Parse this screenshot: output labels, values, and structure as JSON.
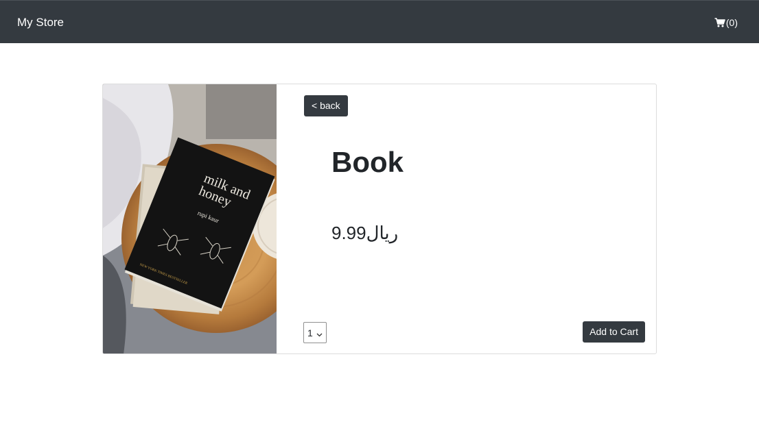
{
  "navbar": {
    "brand": "My Store",
    "cart_icon": "shopping-cart-icon",
    "cart_count": "(0)"
  },
  "product": {
    "back_label": "< back",
    "name": "Book",
    "price": "9.99ريال",
    "quantity": "1",
    "add_to_cart_label": "Add to Cart",
    "image": {
      "book_title_line1": "milk and",
      "book_title_line2": "honey",
      "book_author": "rupi kaur",
      "book_footer": "NEW YORK TIMES BESTSELLER"
    }
  },
  "colors": {
    "navbar_bg": "#343a40",
    "button_bg": "#343a40",
    "text": "#212529"
  }
}
